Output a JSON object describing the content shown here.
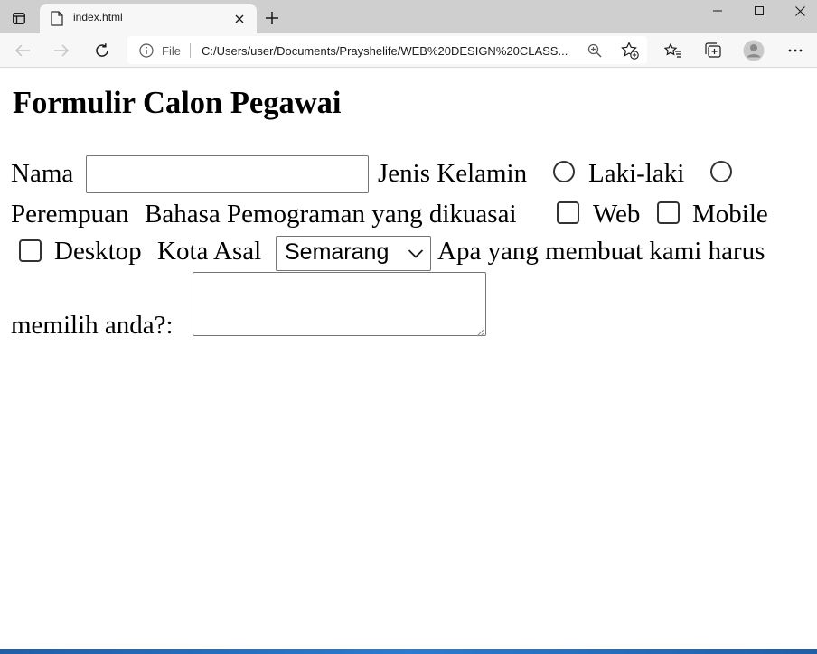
{
  "browser": {
    "tab_title": "index.html",
    "address_scheme_label": "File",
    "address_url": "C:/Users/user/Documents/Prayshelife/WEB%20DESIGN%20CLASS...",
    "icons": [
      "tab-actions-icon",
      "page-icon",
      "close-icon",
      "plus-icon",
      "minimize-icon",
      "maximize-icon",
      "window-close-icon",
      "back-arrow-icon",
      "forward-arrow-icon",
      "refresh-icon",
      "info-icon",
      "zoom-icon",
      "add-favorite-icon",
      "favorites-icon",
      "collections-icon",
      "profile-icon",
      "more-icon"
    ]
  },
  "form": {
    "title": "Formulir Calon Pegawai",
    "nama_label": "Nama",
    "nama_value": "",
    "gender_label": "Jenis Kelamin",
    "gender_options": [
      "Laki-laki",
      "Perempuan"
    ],
    "language_label": "Bahasa Pemograman yang dikuasai",
    "language_options": [
      "Web",
      "Mobile",
      "Desktop"
    ],
    "city_label": "Kota Asal",
    "city_selected": "Semarang",
    "reason_label_line1": "Apa yang membuat kami harus",
    "reason_label_line2": "memilih anda?:",
    "reason_value": ""
  }
}
